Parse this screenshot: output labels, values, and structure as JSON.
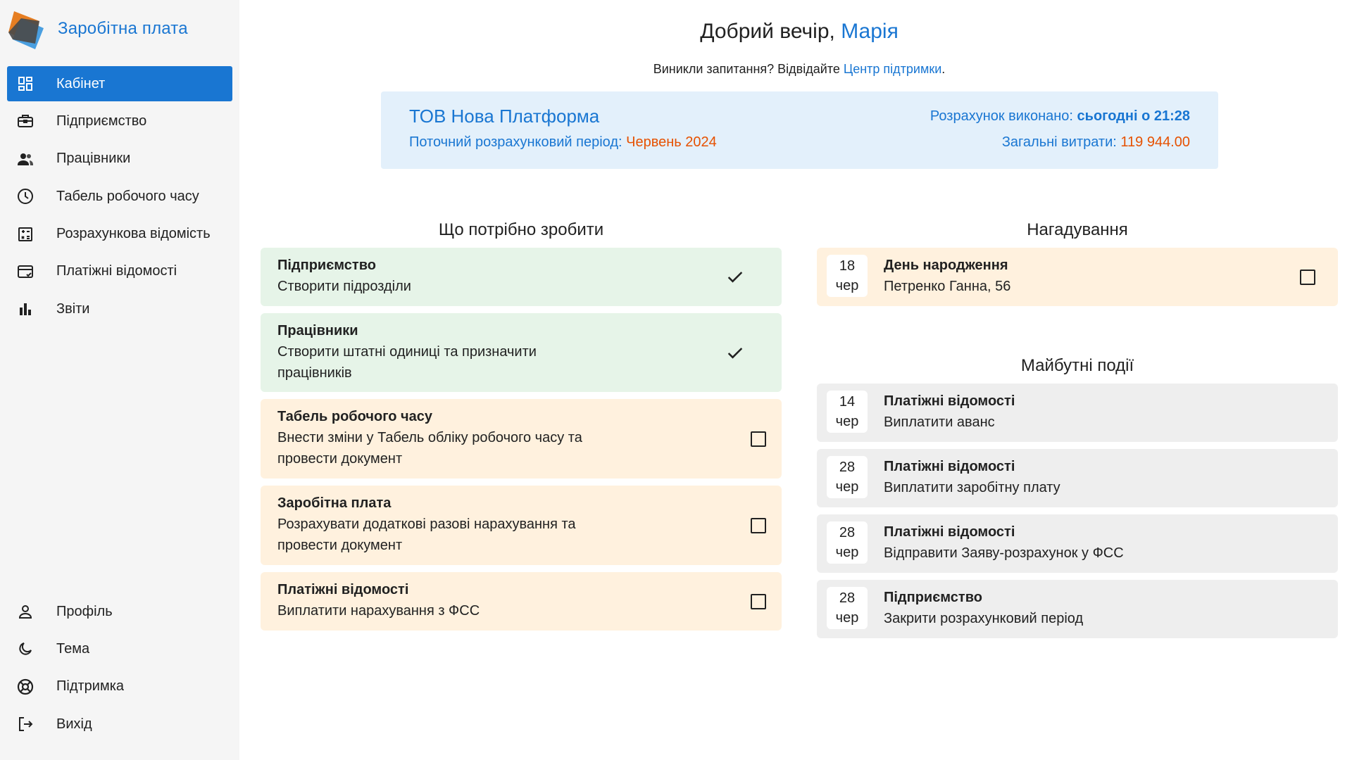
{
  "app": {
    "title": "Заробітна плата"
  },
  "nav": {
    "main": [
      {
        "label": "Кабінет",
        "icon": "dashboard-icon",
        "active": true
      },
      {
        "label": "Підприємство",
        "icon": "briefcase-icon"
      },
      {
        "label": "Працівники",
        "icon": "people-icon"
      },
      {
        "label": "Табель робочого часу",
        "icon": "clock-icon"
      },
      {
        "label": "Розрахункова відомість",
        "icon": "calculator-icon"
      },
      {
        "label": "Платіжні відомості",
        "icon": "payment-card-icon"
      },
      {
        "label": "Звіти",
        "icon": "bar-chart-icon"
      }
    ],
    "bottom": [
      {
        "label": "Профіль",
        "icon": "person-icon"
      },
      {
        "label": "Тема",
        "icon": "moon-icon"
      },
      {
        "label": "Підтримка",
        "icon": "lifebuoy-icon"
      },
      {
        "label": "Вихід",
        "icon": "logout-icon"
      }
    ]
  },
  "greeting": {
    "text": "Добрий вечір,",
    "name": "Марія"
  },
  "support": {
    "text": "Виникли запитання? Відвідайте",
    "link": "Центр підтримки",
    "suffix": "."
  },
  "company": {
    "name": "ТОВ Нова Платформа",
    "calc_label": "Розрахунок виконано:",
    "calc_value": "сьогодні о 21:28",
    "period_label": "Поточний розрахунковий період:",
    "period_value": "Червень 2024",
    "expenses_label": "Загальні витрати:",
    "expenses_value": "119 944.00"
  },
  "todo": {
    "title": "Що потрібно зробити",
    "items": [
      {
        "title": "Підприємство",
        "lines": [
          "Створити підрозділи"
        ],
        "done": true
      },
      {
        "title": "Працівники",
        "lines": [
          "Створити штатні одиниці та призначити",
          "працівників"
        ],
        "done": true
      },
      {
        "title": "Табель робочого часу",
        "lines": [
          "Внести зміни у Табель обліку робочого часу та",
          "провести документ"
        ],
        "done": false
      },
      {
        "title": "Заробітна плата",
        "lines": [
          "Розрахувати додаткові разові нарахування та",
          "провести документ"
        ],
        "done": false
      },
      {
        "title": "Платіжні відомості",
        "lines": [
          "Виплатити нарахування з ФСС"
        ],
        "done": false
      }
    ]
  },
  "reminders": {
    "title": "Нагадування",
    "items": [
      {
        "day": "18",
        "month": "чер",
        "title": "День народження",
        "text": "Петренко Ганна, 56",
        "checked": false
      }
    ]
  },
  "events": {
    "title": "Майбутні події",
    "items": [
      {
        "day": "14",
        "month": "чер",
        "title": "Платіжні відомості",
        "text": "Виплатити аванс"
      },
      {
        "day": "28",
        "month": "чер",
        "title": "Платіжні відомості",
        "text": "Виплатити заробітну плату"
      },
      {
        "day": "28",
        "month": "чер",
        "title": "Платіжні відомості",
        "text": "Відправити Заяву-розрахунок у ФСС"
      },
      {
        "day": "28",
        "month": "чер",
        "title": "Підприємство",
        "text": "Закрити розрахунковий період"
      }
    ]
  },
  "colors": {
    "accent": "#1976d2",
    "orange": "#e65100",
    "done_bg": "#e6f4e8",
    "open_bg": "#fff1de",
    "event_bg": "#eeeeee",
    "company_bg": "#e3f0fb"
  }
}
